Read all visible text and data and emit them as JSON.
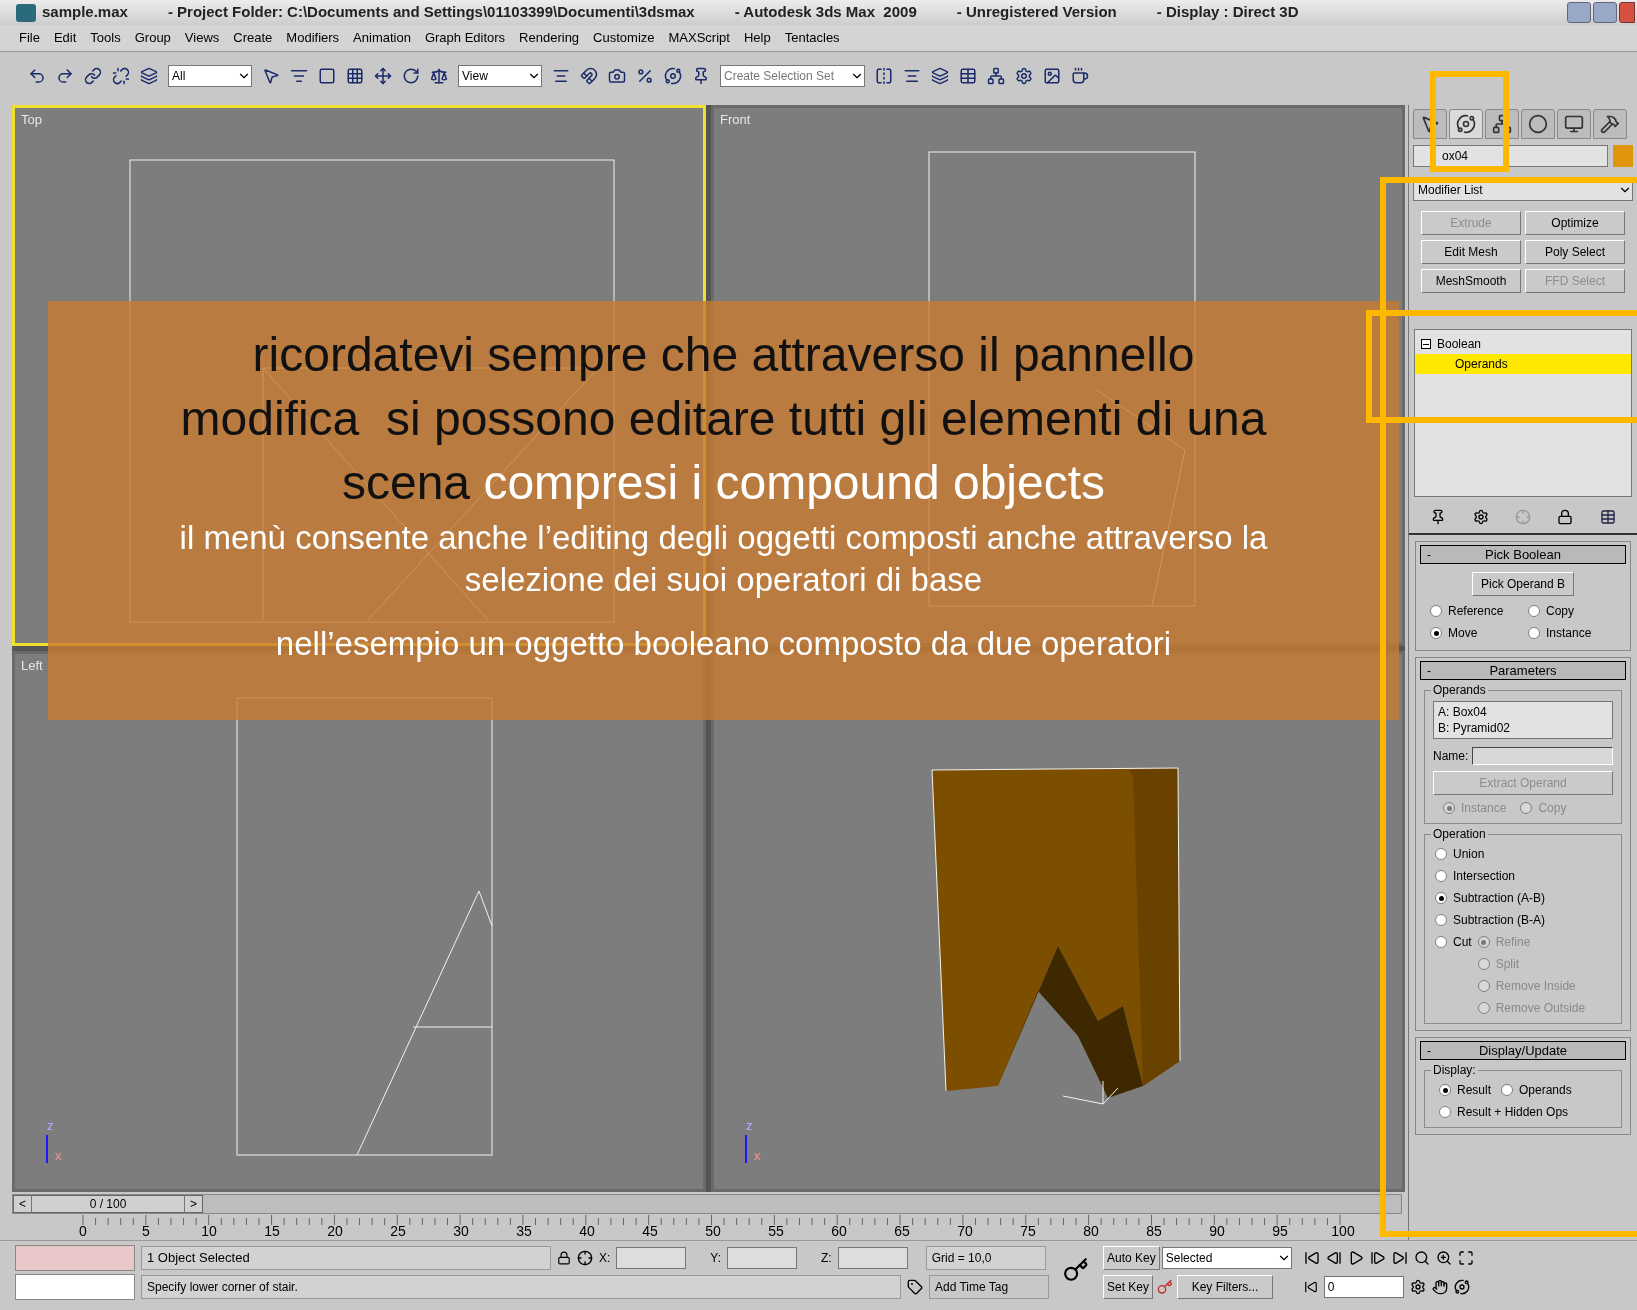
{
  "title_bar": {
    "segments": [
      "sample.max",
      "- Project Folder: C:\\Documents and Settings\\01103399\\Documenti\\3dsmax",
      "- Autodesk 3ds Max  2009",
      "- Unregistered Version",
      "- Display : Direct 3D"
    ]
  },
  "menu": [
    "File",
    "Edit",
    "Tools",
    "Group",
    "Views",
    "Create",
    "Modifiers",
    "Animation",
    "Graph Editors",
    "Rendering",
    "Customize",
    "MAXScript",
    "Help",
    "Tentacles"
  ],
  "toolbar": {
    "selection_filter": "All",
    "reference_coord": "View",
    "selection_set": "Create Selection Set"
  },
  "viewports": [
    {
      "label": "Top",
      "active": true,
      "kind": "top"
    },
    {
      "label": "Front",
      "active": false,
      "kind": "front"
    },
    {
      "label": "Left",
      "active": false,
      "kind": "left",
      "axis_up": "z",
      "axis_right": "x"
    },
    {
      "active": false,
      "kind": "perspective",
      "axis_up": "z",
      "axis_right": "x"
    }
  ],
  "callout": {
    "headline": [
      [
        {
          "text": "ricordatevi sempre che attraverso il pannello",
          "color": "#111111"
        }
      ],
      [
        {
          "text": "modifica  si possono editare tutti gli elementi di una",
          "color": "#111111"
        }
      ],
      [
        {
          "text": "scena ",
          "color": "#111111"
        },
        {
          "text": "compresi i compound objects",
          "color": "#ffffff"
        }
      ]
    ],
    "note": [
      "il menù consente anche l’editing degli oggetti composti anche attraverso la",
      "selezione dei suoi operatori di base"
    ],
    "example": "nell’esempio un oggetto booleano composto da due operatori"
  },
  "command_panel": {
    "tabs": [
      {
        "kind": "create",
        "selected": false
      },
      {
        "kind": "modify",
        "selected": true
      },
      {
        "kind": "hierarchy",
        "selected": false
      },
      {
        "kind": "motion",
        "selected": false
      },
      {
        "kind": "display",
        "selected": false
      },
      {
        "kind": "utilities",
        "selected": false
      }
    ],
    "object": {
      "name": "ox04",
      "color": "#e0960c"
    },
    "modifier_list": "Modifier List",
    "modifier_buttons": [
      {
        "label": "Extrude",
        "disabled": true
      },
      {
        "label": "Optimize",
        "disabled": false
      },
      {
        "label": "Edit Mesh",
        "disabled": false
      },
      {
        "label": "Poly Select",
        "disabled": false
      },
      {
        "label": "MeshSmooth",
        "disabled": false
      },
      {
        "label": "FFD Select",
        "disabled": true
      }
    ],
    "stack": [
      {
        "label": "Boolean",
        "expanded": true,
        "selected": false,
        "children": [
          {
            "label": "Operands",
            "selected": true
          }
        ]
      }
    ],
    "pick_boolean": {
      "sign": "-",
      "title": "Pick Boolean",
      "button": "Pick Operand B",
      "options": [
        {
          "label": "Reference",
          "selected": false
        },
        {
          "label": "Copy",
          "selected": false
        },
        {
          "label": "Move",
          "selected": true
        },
        {
          "label": "Instance",
          "selected": false
        }
      ]
    },
    "parameters": {
      "sign": "-",
      "title": "Parameters",
      "operands_label": "Operands",
      "operands": [
        "A: Box04",
        "B: Pyramid02"
      ],
      "name_label": "Name:",
      "extract_button": {
        "label": "Extract Operand",
        "disabled": true
      },
      "extract_options": [
        {
          "label": "Instance",
          "selected": true,
          "disabled": true
        },
        {
          "label": "Copy",
          "selected": false,
          "disabled": true
        }
      ],
      "operation_label": "Operation",
      "operations": [
        {
          "label": "Union",
          "selected": false
        },
        {
          "label": "Intersection",
          "selected": false
        },
        {
          "label": "Subtraction (A-B)",
          "selected": true
        },
        {
          "label": "Subtraction (B-A)",
          "selected": false
        },
        {
          "label": "Cut",
          "selected": false
        }
      ],
      "cut_options": [
        {
          "label": "Refine",
          "selected": true,
          "disabled": true
        },
        {
          "label": "Split",
          "selected": false,
          "disabled": true
        },
        {
          "label": "Remove Inside",
          "selected": false,
          "disabled": true
        },
        {
          "label": "Remove Outside",
          "selected": false,
          "disabled": true
        }
      ]
    },
    "display_update": {
      "sign": "-",
      "title": "Display/Update",
      "display_label": "Display:",
      "options": [
        {
          "label": "Result",
          "selected": true
        },
        {
          "label": "Operands",
          "selected": false
        },
        {
          "label": "Result + Hidden Ops",
          "selected": false
        }
      ]
    }
  },
  "time_slider": {
    "label": "0 / 100",
    "level": 0,
    "prev": "<",
    "next": ">"
  },
  "ruler": [
    "0",
    "5",
    "10",
    "15",
    "20",
    "25",
    "30",
    "35",
    "40",
    "45",
    "50",
    "55",
    "60",
    "65",
    "70",
    "75",
    "80",
    "85",
    "90",
    "95",
    "100"
  ],
  "status": {
    "selection": "1 Object Selected",
    "prompt": "Specify lower corner of stair.",
    "x_label": "X:",
    "y_label": "Y:",
    "z_label": "Z:",
    "grid": "Grid = 10,0",
    "auto_key": "Auto Key",
    "key_mode": "Selected",
    "set_key": "Set Key",
    "key_filters": "Key Filters...",
    "add_time_tag": "Add Time Tag",
    "frame": "0"
  }
}
